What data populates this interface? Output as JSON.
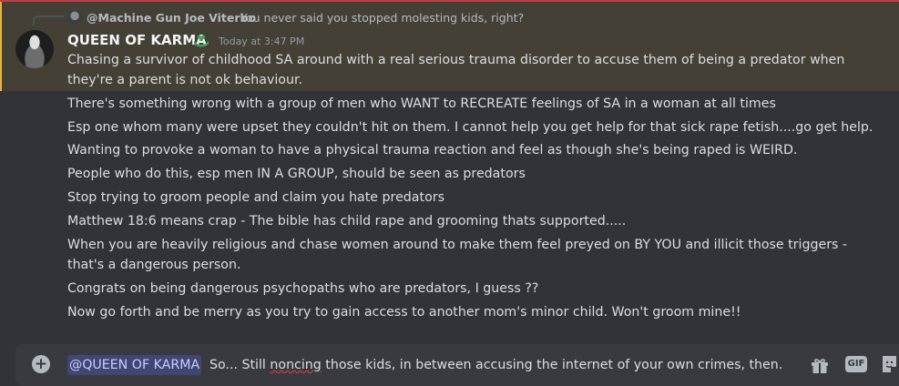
{
  "reply": {
    "author": "@Machine Gun Joe Viterbo",
    "text": "You never said you stopped molesting kids, right?"
  },
  "message": {
    "author": "QUEEN OF KARMA",
    "timestamp": "Today at 3:47 PM",
    "first_text": "Chasing a survivor of childhood SA around with a real serious trauma disorder to accuse them of being a predator when they're a parent is not ok behaviour."
  },
  "followups": [
    "There's something wrong with a group of men who WANT to RECREATE feelings of SA in a woman at all times",
    "Esp one whom many were upset they couldn't hit on them. I cannot help you get help for that sick rape fetish....go get help.",
    "Wanting to provoke a woman to have a physical trauma reaction and feel as though she's being raped is WEIRD.",
    "People who do this, esp men IN A GROUP, should be seen as predators",
    "Stop trying to groom people and claim you hate predators",
    "Matthew 18:6 means crap - The bible has child rape and grooming thats supported.....",
    "When you are heavily religious and chase women around to make them feel preyed on BY YOU and illicit those triggers - that's a dangerous person.",
    "Congrats on being dangerous psychopaths who are predators, I guess ??",
    "Now go forth and be merry as you try to gain access to another mom's minor child. Won't groom mine!!"
  ],
  "composer": {
    "mention": "@QUEEN OF KARMA",
    "draft_before": "So... Still ",
    "draft_misspelled": "noncing",
    "draft_after": " those kids, in between accusing the internet of your own crimes, then.",
    "gif_label": "GIF",
    "plus_label": "+"
  },
  "icons": {
    "author_badge": "hand-heart-icon",
    "composer_right": [
      "gift-icon",
      "gif-button",
      "sticker-icon"
    ]
  },
  "colors": {
    "background": "#313338",
    "mention_highlight": "#444036",
    "mention_bar": "#f0b232",
    "composer": "#383a40",
    "badge_green": "#3ba55c"
  }
}
